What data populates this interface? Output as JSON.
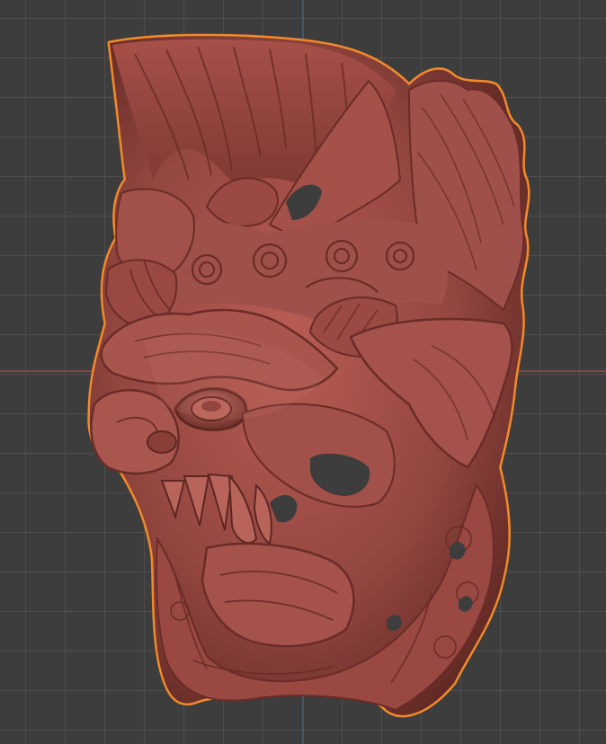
{
  "viewport": {
    "background_color": "#3d3d3d",
    "grid_color": "#505050",
    "x_axis_color": "#8a4b4b",
    "y_axis_color": "#4a6a8a"
  },
  "model": {
    "subject": "carved-mask-model",
    "base_color": "#9a4a43",
    "shadow_color": "#5a2520",
    "highlight_color": "#c9766c",
    "selection_outline_color": "#f28a2a",
    "selected": true
  }
}
